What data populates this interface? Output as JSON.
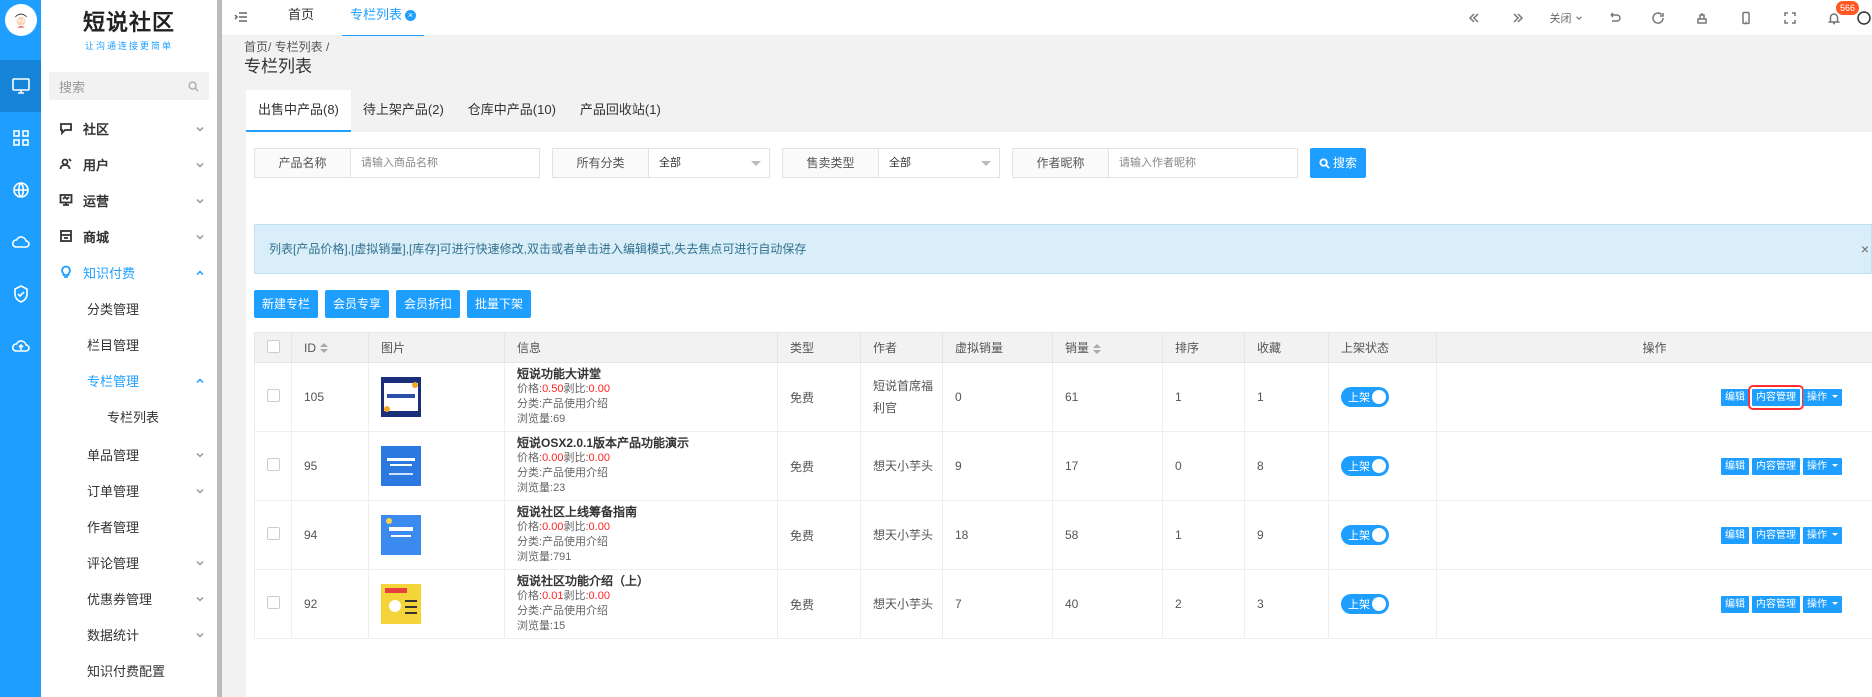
{
  "app": {
    "logo_text": "短说社区",
    "logo_sub": "让沟通连接更简单"
  },
  "menu": {
    "search_placeholder": "搜索",
    "items": [
      {
        "label": "社区",
        "icon": "chat-icon"
      },
      {
        "label": "用户",
        "icon": "user-icon"
      },
      {
        "label": "运营",
        "icon": "monitor-icon"
      },
      {
        "label": "商城",
        "icon": "store-icon"
      },
      {
        "label": "知识付费",
        "icon": "bulb-icon"
      }
    ],
    "sub": [
      "分类管理",
      "栏目管理",
      "专栏管理",
      "专栏列表",
      "单品管理",
      "订单管理",
      "作者管理",
      "评论管理",
      "优惠券管理",
      "数据统计",
      "知识付费配置"
    ]
  },
  "topbar": {
    "home_tab": "首页",
    "active_tab": "专栏列表",
    "close_label": "关闭",
    "badge": "566"
  },
  "page": {
    "breadcrumb": "首页/ 专栏列表 /",
    "title": "专栏列表",
    "tabs": [
      "出售中产品(8)",
      "待上架产品(2)",
      "仓库中产品(10)",
      "产品回收站(1)"
    ]
  },
  "filters": {
    "name_label": "产品名称",
    "name_placeholder": "请输入商品名称",
    "category_label": "所有分类",
    "category_value": "全部",
    "sale_label": "售卖类型",
    "sale_value": "全部",
    "author_label": "作者昵称",
    "author_placeholder": "请输入作者昵称",
    "search_btn": "搜索"
  },
  "notice": {
    "text": "列表[产品价格],[虚拟销量],[库存]可进行快速修改,双击或者单击进入编辑模式,失去焦点可进行自动保存",
    "close": "×"
  },
  "actions": [
    "新建专栏",
    "会员专享",
    "会员折扣",
    "批量下架"
  ],
  "table": {
    "headers": [
      "ID",
      "图片",
      "信息",
      "类型",
      "作者",
      "虚拟销量",
      "销量",
      "排序",
      "收藏",
      "上架状态",
      "操作"
    ],
    "price_label": "价格:",
    "discount_label": "剥比:",
    "category_label": "分类:",
    "views_label": "浏览量:",
    "status_label": "上架",
    "btn_edit": "编辑",
    "btn_content": "内容管理",
    "btn_ops": "操作",
    "rows": [
      {
        "id": "105",
        "name": "短说功能大讲堂",
        "price": "0.50",
        "discount": "0.00",
        "category": "产品使用介绍",
        "views": "69",
        "type": "免费",
        "author": "短说首席福利官",
        "virtual": "0",
        "sales": "61",
        "sort": "1",
        "fav": "1",
        "thumb_color": "#2c4fa8"
      },
      {
        "id": "95",
        "name": "短说OSX2.0.1版本产品功能演示",
        "price": "0.00",
        "discount": "0.00",
        "category": "产品使用介绍",
        "views": "23",
        "type": "免费",
        "author": "想天小芋头",
        "virtual": "9",
        "sales": "17",
        "sort": "0",
        "fav": "8",
        "thumb_color": "#2a78e0"
      },
      {
        "id": "94",
        "name": "短说社区上线筹备指南",
        "price": "0.00",
        "discount": "0.00",
        "category": "产品使用介绍",
        "views": "791",
        "type": "免费",
        "author": "想天小芋头",
        "virtual": "18",
        "sales": "58",
        "sort": "1",
        "fav": "9",
        "thumb_color": "#3a8af0"
      },
      {
        "id": "92",
        "name": "短说社区功能介绍（上）",
        "price": "0.01",
        "discount": "0.00",
        "category": "产品使用介绍",
        "views": "15",
        "type": "免费",
        "author": "想天小芋头",
        "virtual": "7",
        "sales": "40",
        "sort": "2",
        "fav": "3",
        "thumb_color": "#f5d43a"
      }
    ]
  }
}
